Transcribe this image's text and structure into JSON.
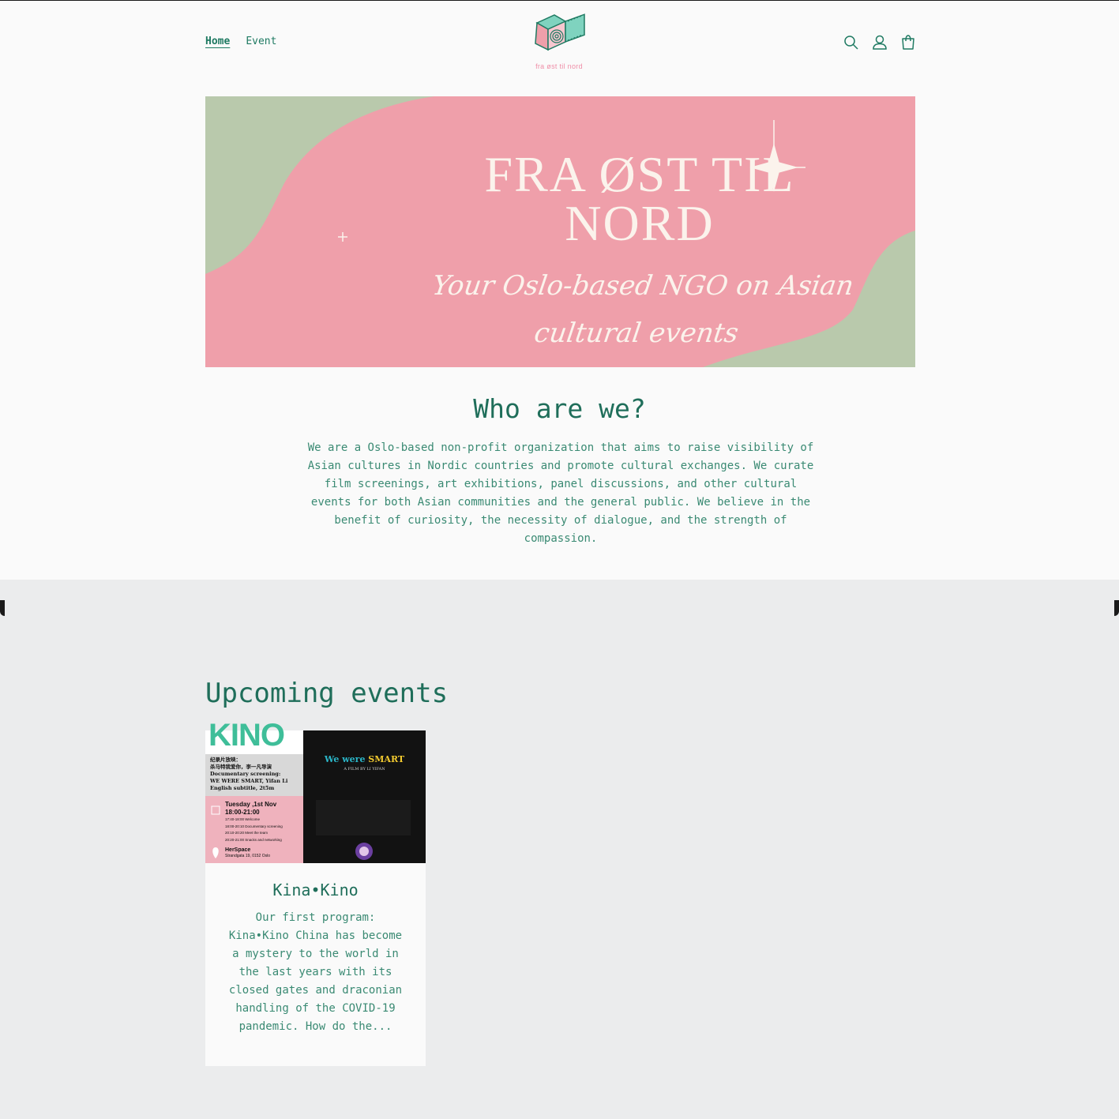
{
  "header": {
    "nav": [
      {
        "label": "Home",
        "active": true
      },
      {
        "label": "Event",
        "active": false
      }
    ],
    "logo_text": "fra øst til nord",
    "icons": [
      "search-icon",
      "account-icon",
      "cart-icon"
    ]
  },
  "hero": {
    "title_line1": "FRA ØST TIL",
    "title_line2": "NORD",
    "subtitle_line1": "Your Oslo-based NGO on Asian",
    "subtitle_line2": "cultural events",
    "colors": {
      "pink": "#ef9faa",
      "green": "#b9c9ac",
      "cream": "#fbf3ec"
    }
  },
  "about": {
    "heading": "Who are we?",
    "text": "We are a Oslo-based non-profit organization that aims to raise visibility of Asian cultures in Nordic countries and promote cultural exchanges. We curate film screenings, art exhibitions, panel discussions, and other cultural events for both Asian communities and the general public. We believe in the benefit of curiosity, the necessity of dialogue, and the strength of compassion."
  },
  "events": {
    "heading": "Upcoming events",
    "items": [
      {
        "title": "Kina•Kino",
        "excerpt": "Our first program: Kina•Kino  China has become a mystery to the world in the last years with its closed gates and draconian handling of the COVID-19 pandemic. How do the...",
        "poster": {
          "brand": "KINO",
          "chinese_line1": "纪录片放映：",
          "chinese_line2": "杀马特我爱你，李一凡导演",
          "line1": "Documentary screening:",
          "line2": "WE WERE SMART, Yifan Li",
          "line3": "English subtitle, 2t5m",
          "date": "Tuesday ,1st Nov",
          "time": "18:00-21:00",
          "schedule": [
            "17:40-18:00 Welcome",
            "18:00-20:10 Documentary screening",
            "20:10-20:20 Meet the team",
            "20:20-21:00 Snacks and networking"
          ],
          "venue": "HerSpace",
          "address": "Strandgata 19, 0152 Oslo",
          "film_title_a": "We were ",
          "film_title_b": "SMART",
          "film_by": "A FILM BY LI YIFAN"
        }
      }
    ]
  },
  "accent_color": "#1f7a62"
}
